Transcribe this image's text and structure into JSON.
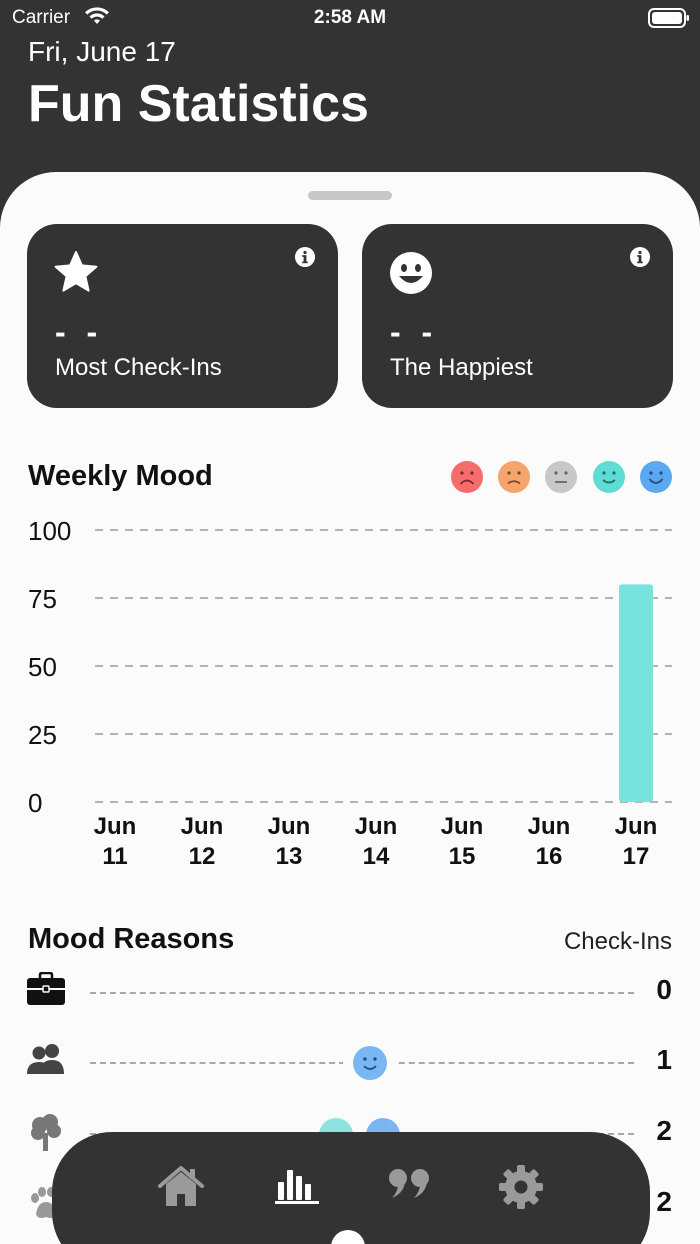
{
  "status": {
    "carrier": "Carrier",
    "time": "2:58 AM"
  },
  "header": {
    "date": "Fri, June 17",
    "title": "Fun Statistics"
  },
  "cards": [
    {
      "icon": "star-icon",
      "value": "- -",
      "label": "Most Check-Ins"
    },
    {
      "icon": "smiley-icon",
      "value": "- -",
      "label": "The Happiest"
    }
  ],
  "weekly_mood": {
    "title": "Weekly Mood",
    "legend_colors": [
      "#f56c6c",
      "#f5a46c",
      "#c8c8c8",
      "#5fdcd4",
      "#5aa8f0"
    ],
    "y_ticks": [
      "100",
      "75",
      "50",
      "25",
      "0"
    ],
    "x_month": "Jun",
    "x_days": [
      "11",
      "12",
      "13",
      "14",
      "15",
      "16",
      "17"
    ]
  },
  "chart_data": {
    "type": "bar",
    "categories": [
      "Jun 11",
      "Jun 12",
      "Jun 13",
      "Jun 14",
      "Jun 15",
      "Jun 16",
      "Jun 17"
    ],
    "values": [
      0,
      0,
      0,
      0,
      0,
      0,
      80
    ],
    "title": "Weekly Mood",
    "xlabel": "",
    "ylabel": "",
    "ylim": [
      0,
      100
    ],
    "grid": true,
    "bar_color": "#76e3dd"
  },
  "reasons": {
    "title": "Mood Reasons",
    "column_label": "Check-Ins",
    "rows": [
      {
        "icon": "briefcase-icon",
        "count": "0"
      },
      {
        "icon": "people-icon",
        "count": "1"
      },
      {
        "icon": "tree-icon",
        "count": "2"
      },
      {
        "icon": "paw-icon",
        "count": "2"
      }
    ]
  },
  "tabbar": {
    "tabs": [
      "home-icon",
      "stats-icon",
      "quote-icon",
      "gear-icon"
    ],
    "active": "stats-icon"
  }
}
